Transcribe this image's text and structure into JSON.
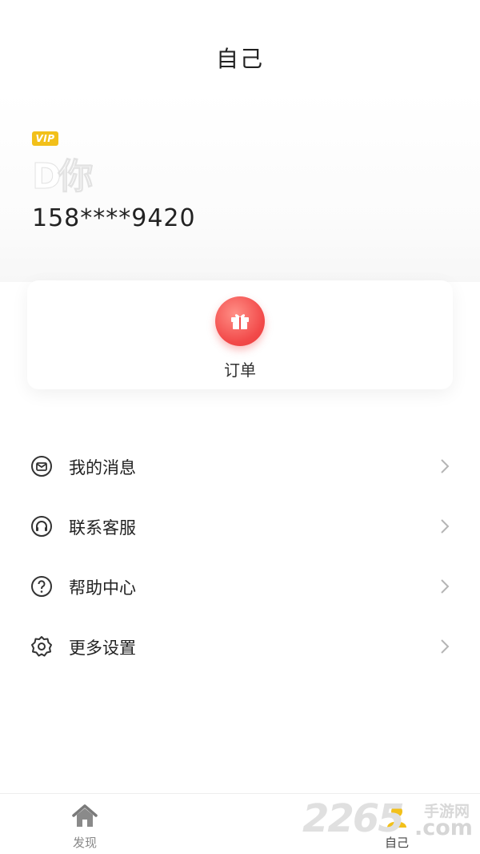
{
  "header": {
    "title": "自己"
  },
  "profile": {
    "vip_label": "VIP",
    "avatar_text": "D你",
    "phone": "158****9420"
  },
  "order_card": {
    "label": "订单",
    "icon": "gift-icon",
    "accent": "#f24a4a"
  },
  "menu": {
    "items": [
      {
        "label": "我的消息",
        "icon": "message-icon"
      },
      {
        "label": "联系客服",
        "icon": "headset-icon"
      },
      {
        "label": "帮助中心",
        "icon": "help-icon"
      },
      {
        "label": "更多设置",
        "icon": "gear-icon"
      }
    ]
  },
  "tabbar": {
    "tabs": [
      {
        "label": "发现",
        "icon": "home-icon"
      },
      {
        "label": "自己",
        "icon": "profile-icon",
        "active_color": "#f2c01a"
      }
    ]
  },
  "watermark": {
    "number": "2265",
    "cn": "手游网",
    "domain": ".com"
  }
}
